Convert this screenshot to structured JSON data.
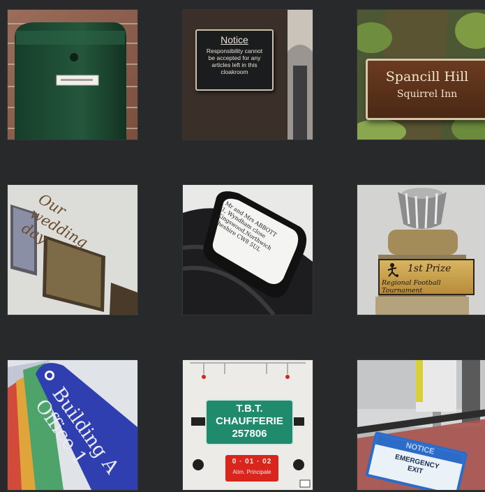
{
  "tiles": {
    "notice": {
      "heading": "Notice",
      "body_lines": [
        "Responsibility cannot",
        "be accepted for any",
        "articles left in this",
        "cloakroom"
      ]
    },
    "squirrel": {
      "line1": "Spancill Hill",
      "line2": "Squirrel Inn"
    },
    "wedding": {
      "text": "Our wedding day"
    },
    "luggage": {
      "text": "Mr and Mrs ABBOTT\n1, Wyndham close\nKingswood,Northwich\nCheshire CW8 5UL"
    },
    "trophy": {
      "prize": "1st Prize",
      "subtitle": "Regional Football Tournament"
    },
    "keytag": {
      "text": "Building A\nOffice 1"
    },
    "panel": {
      "line1": "T.B.T.",
      "line2": "CHAUFFERIE",
      "line3": "257806",
      "red_code": "0 · 01 · 02",
      "red_label": "Alim. Principale"
    },
    "exit": {
      "header": "NOTICE",
      "line1": "EMERGENCY",
      "line2": "EXIT"
    }
  },
  "colors": {
    "background": "#27292b",
    "mailbox_green": "#1f4a33",
    "sign_brown": "#5a301a",
    "tag_blue": "#2f3fb0",
    "panel_green": "#1f8a6c",
    "panel_red": "#d8261c",
    "exit_blue": "#2c6cc8"
  }
}
